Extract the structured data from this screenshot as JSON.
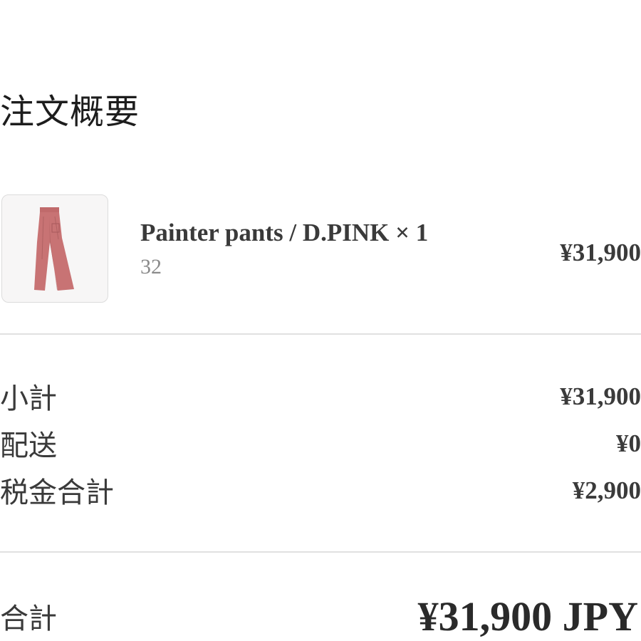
{
  "order_summary": {
    "title": "注文概要"
  },
  "item": {
    "thumbnail_icon": "pants-product-image",
    "thumbnail_color": "#c76f6f",
    "name": "Painter pants / D.PINK × 1",
    "variant": "32",
    "price": "¥31,900"
  },
  "totals": {
    "subtotal_label": "小計",
    "subtotal_value": "¥31,900",
    "shipping_label": "配送",
    "shipping_value": "¥0",
    "tax_label": "税金合計",
    "tax_value": "¥2,900",
    "grand_total_label": "合計",
    "grand_total_value": "¥31,900 JPY"
  }
}
